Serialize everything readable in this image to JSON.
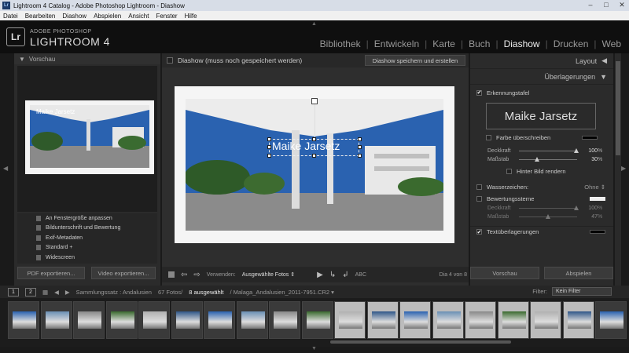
{
  "window": {
    "title": "Lightroom 4 Catalog - Adobe Photoshop Lightroom - Diashow",
    "icon": "Lr",
    "controls": [
      "–",
      "□",
      "✕"
    ]
  },
  "menu": [
    "Datei",
    "Bearbeiten",
    "Diashow",
    "Abspielen",
    "Ansicht",
    "Fenster",
    "Hilfe"
  ],
  "brand": {
    "badge": "Lr",
    "line1": "ADOBE PHOTOSHOP",
    "line2": "LIGHTROOM 4"
  },
  "modules": [
    {
      "label": "Bibliothek",
      "active": false
    },
    {
      "label": "Entwickeln",
      "active": false
    },
    {
      "label": "Karte",
      "active": false
    },
    {
      "label": "Buch",
      "active": false
    },
    {
      "label": "Diashow",
      "active": true
    },
    {
      "label": "Drucken",
      "active": false
    },
    {
      "label": "Web",
      "active": false
    }
  ],
  "left": {
    "preview_header": "Vorschau",
    "preview_overlay": "Maike Jarsetz",
    "templates": [
      "An Fenstergröße anpassen",
      "Bildunterschrift und Bewertung",
      "Exif-Metadaten",
      "Standard +",
      "Widescreen"
    ],
    "export_pdf": "PDF exportieren...",
    "export_video": "Video exportieren..."
  },
  "center": {
    "title": "Diashow (muss noch gespeichert werden)",
    "save_button": "Diashow speichern und erstellen",
    "identity_plate": "Maike Jarsetz",
    "toolbar": {
      "use_label": "Verwenden:",
      "use_value": "Ausgewählte Fotos ⇕",
      "abc": "ABC",
      "slide_info": "Dia 4 von 8"
    }
  },
  "right": {
    "layout": "Layout",
    "overlays": "Überlagerungen",
    "identity_plate_label": "Erkennungstafel",
    "identity_plate_preview": "Maike Jarsetz",
    "override_color": "Farbe überschreiben",
    "opacity_label": "Deckkraft",
    "opacity_value": "100",
    "opacity_unit": "%",
    "scale_label": "Maßstab",
    "scale_value": "30",
    "scale_unit": "%",
    "behind_image": "Hinter Bild rendern",
    "watermark_label": "Wasserzeichen:",
    "watermark_value": "Ohne ⇕",
    "rating_label": "Bewertungssterne",
    "rating_opacity_label": "Deckkraft",
    "rating_opacity_value": "100",
    "rating_scale_label": "Maßstab",
    "rating_scale_value": "47",
    "text_overlays": "Textüberlagerungen",
    "preview_button": "Vorschau",
    "play_button": "Abspielen"
  },
  "filmbar": {
    "btn1": "1",
    "btn2": "2",
    "path_prefix": "Sammlungssatz : Andalusien",
    "count": "67 Fotos/",
    "selected": "8 ausgewählt",
    "file": "/ Malaga_Andalusien_2011-7951.CR2 ▾",
    "filter_label": "Filter:",
    "filter_value": "Kein Filter"
  },
  "colors": {
    "sky": "#2a62b0",
    "accent": "#eeeeee"
  }
}
